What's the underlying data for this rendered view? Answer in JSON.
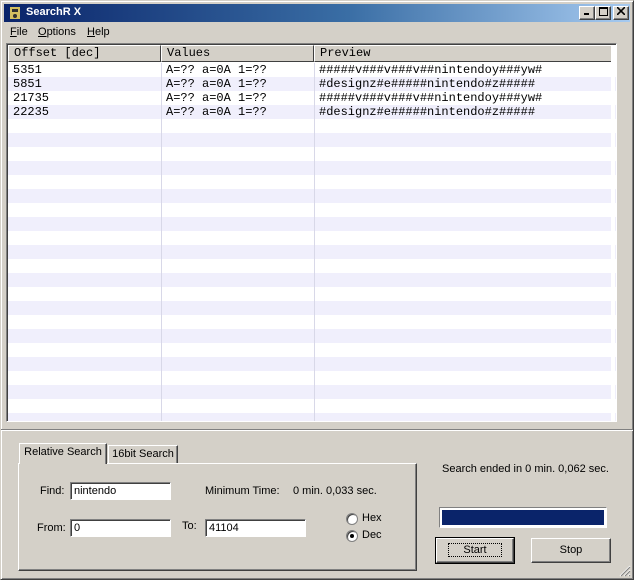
{
  "window": {
    "title": "SearchR X",
    "app_icon": "app-icon"
  },
  "menubar": {
    "items": [
      {
        "label_u": "F",
        "label_rest": "ile"
      },
      {
        "label_u": "O",
        "label_rest": "ptions"
      },
      {
        "label_u": "H",
        "label_rest": "elp"
      }
    ]
  },
  "results": {
    "columns": [
      "Offset [dec]",
      "Values",
      "Preview"
    ],
    "rows": [
      {
        "offset": "5351",
        "values": "A=?? a=0A 1=??",
        "preview": "#####v###v###v##nintendoy###yw#"
      },
      {
        "offset": "5851",
        "values": "A=?? a=0A 1=??",
        "preview": "#designz#e#####nintendo#z#####"
      },
      {
        "offset": "21735",
        "values": "A=?? a=0A 1=??",
        "preview": "#####v###v###v##nintendoy###yw#"
      },
      {
        "offset": "22235",
        "values": "A=?? a=0A 1=??",
        "preview": "#designz#e#####nintendo#z#####"
      }
    ]
  },
  "tabs": [
    {
      "label": "Relative Search",
      "active": true
    },
    {
      "label": "16bit Search",
      "active": false
    }
  ],
  "search": {
    "find_label": "Find:",
    "find_value": "nintendo",
    "min_time_label": "Minimum Time:",
    "min_time_value": "0 min. 0,033 sec.",
    "from_label": "From:",
    "from_value": "0",
    "to_label": "To:",
    "to_value": "41104",
    "radix_hex": "Hex",
    "radix_dec": "Dec",
    "radix_selected": "Dec"
  },
  "status": {
    "message": "Search ended in 0 min. 0,062 sec.",
    "progress": 1.0
  },
  "buttons": {
    "start": "Start",
    "stop": "Stop"
  },
  "colors": {
    "title_start": "#0a246a",
    "title_end": "#a6caf0",
    "progress": "#0a246a",
    "row_stripe": "#f0effc"
  }
}
